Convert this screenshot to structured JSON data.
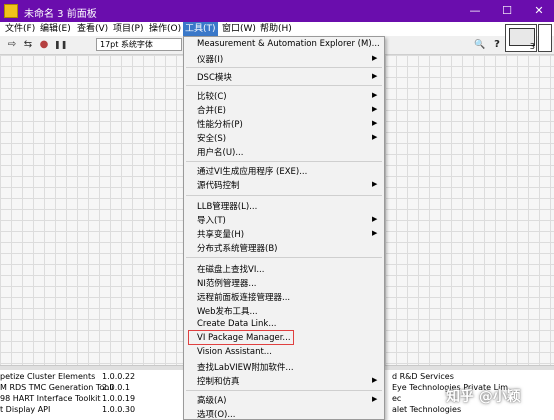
{
  "window": {
    "title": "未命名 3 前面板",
    "controls": {
      "minimize": "—",
      "maximize": "☐",
      "close": "✕"
    }
  },
  "menubar": [
    {
      "label": "文件(F)",
      "active": false
    },
    {
      "label": "编辑(E)",
      "active": false
    },
    {
      "label": "查看(V)",
      "active": false
    },
    {
      "label": "项目(P)",
      "active": false
    },
    {
      "label": "操作(O)",
      "active": false
    },
    {
      "label": "工具(T)",
      "active": true
    },
    {
      "label": "窗口(W)",
      "active": false
    },
    {
      "label": "帮助(H)",
      "active": false
    }
  ],
  "toolbar": {
    "font_selector": "17pt 系统字体",
    "run_glyph": "⇨",
    "run_cont_glyph": "⇆",
    "abort_glyph": "●",
    "pause_glyph": "❚❚",
    "search_glyph": "🔍",
    "help_glyph": "?",
    "vi_icon_number": "3",
    "accent_color": "#6a0dad"
  },
  "tools_menu": [
    {
      "label": "Measurement & Automation Explorer (M)...",
      "submenu": false
    },
    {
      "label": "仪器(I)",
      "submenu": true
    },
    {
      "label": "DSC模块",
      "submenu": true
    },
    {
      "label": "比较(C)",
      "submenu": true
    },
    {
      "label": "合并(E)",
      "submenu": true
    },
    {
      "label": "性能分析(P)",
      "submenu": true
    },
    {
      "label": "安全(S)",
      "submenu": true
    },
    {
      "label": "用户名(U)...",
      "submenu": false
    },
    {
      "label": "通过VI生成应用程序 (EXE)...",
      "submenu": false
    },
    {
      "label": "源代码控制",
      "submenu": true
    },
    {
      "label": "LLB管理器(L)...",
      "submenu": false
    },
    {
      "label": "导入(T)",
      "submenu": true
    },
    {
      "label": "共享变量(H)",
      "submenu": true
    },
    {
      "label": "分布式系统管理器(B)",
      "submenu": false
    },
    {
      "label": "在磁盘上查找VI...",
      "submenu": false
    },
    {
      "label": "NI范例管理器...",
      "submenu": false
    },
    {
      "label": "远程前面板连接管理器...",
      "submenu": false
    },
    {
      "label": "Web发布工具...",
      "submenu": false
    },
    {
      "label": "Create Data Link...",
      "submenu": false
    },
    {
      "label": "VI Package Manager...",
      "submenu": false,
      "highlighted": true
    },
    {
      "label": "Vision Assistant...",
      "submenu": false
    },
    {
      "label": "查找LabVIEW附加软件...",
      "submenu": false
    },
    {
      "label": "控制和仿真",
      "submenu": true
    },
    {
      "label": "高级(A)",
      "submenu": true
    },
    {
      "label": "选项(O)...",
      "submenu": false
    }
  ],
  "packages": [
    {
      "name": "petize Cluster Elements",
      "version": "1.0.0.22",
      "vendor": "d R&D Services"
    },
    {
      "name": "M RDS TMC Generation Tooli",
      "version": "2.0.0.1",
      "vendor": "Eye Technologies Private Lim"
    },
    {
      "name": "98 HART Interface Toolkit",
      "version": "1.0.0.19",
      "vendor": "ec"
    },
    {
      "name": "t Display API",
      "version": "1.0.0.30",
      "vendor": "alet Technologies"
    }
  ],
  "watermark": "知乎 @小颖"
}
